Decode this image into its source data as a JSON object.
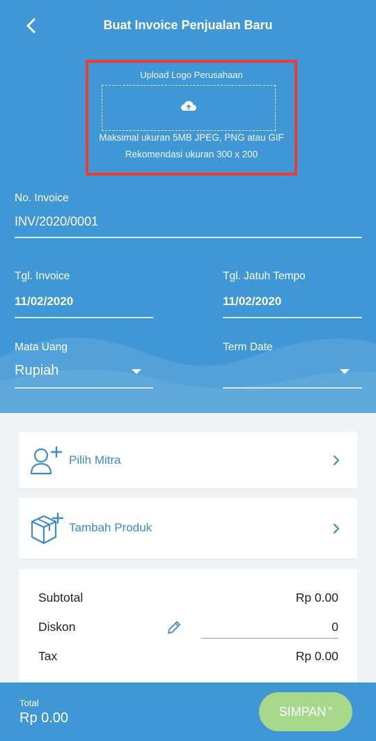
{
  "header": {
    "title": "Buat Invoice Penjualan Baru"
  },
  "logo_upload": {
    "title": "Upload Logo Perusahaan",
    "note_size": "Maksimal ukuran 5MB JPEG, PNG atau GIF",
    "note_recommend": "Rekomendasi ukuran 300 x 200"
  },
  "form": {
    "invoice_no": {
      "label": "No. Invoice",
      "value": "INV/2020/0001"
    },
    "invoice_date": {
      "label": "Tgl. Invoice",
      "value": "11/02/2020"
    },
    "due_date": {
      "label": "Tgl. Jatuh Tempo",
      "value": "11/02/2020"
    },
    "currency": {
      "label": "Mata Uang",
      "value": "Rupiah"
    },
    "term_date": {
      "label": "Term Date",
      "value": ""
    }
  },
  "cards": {
    "partner": {
      "label": "Pilih Mitra"
    },
    "product": {
      "label": "Tambah Produk"
    }
  },
  "summary": {
    "subtotal": {
      "label": "Subtotal",
      "value": "Rp 0.00"
    },
    "discount": {
      "label": "Diskon",
      "value": "0"
    },
    "tax": {
      "label": "Tax",
      "value": "Rp 0.00"
    }
  },
  "footer": {
    "total_label": "Total",
    "total_value": "Rp 0.00",
    "save_label": "SIMPAN",
    "save_arrow": "^"
  },
  "colors": {
    "primary": "#3f97d6",
    "highlight_border": "#f23a31",
    "save_button": "#a8d98b",
    "card_text": "#3a8cc8"
  }
}
